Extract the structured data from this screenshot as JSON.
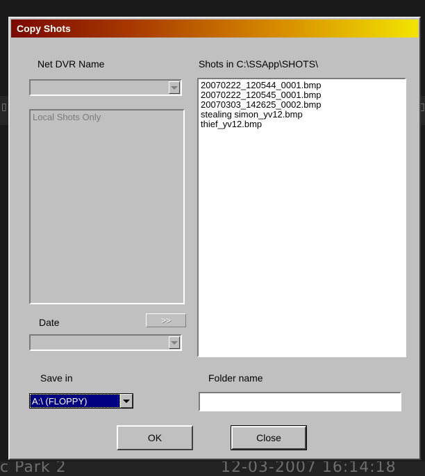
{
  "dialog": {
    "title": "Copy Shots",
    "net_dvr_label": "Net DVR Name",
    "net_dvr_value": "",
    "dvr_list_items": [
      "Local Shots Only"
    ],
    "shots_label": "Shots  in  C:\\SSApp\\SHOTS\\",
    "shots": [
      "20070222_120544_0001.bmp",
      "20070222_120545_0001.bmp",
      "20070303_142625_0002.bmp",
      "stealing simon_yv12.bmp",
      "thief_yv12.bmp"
    ],
    "date_label": "Date",
    "date_button": ">>",
    "date_value": "",
    "save_in_label": "Save in",
    "save_in_value": "A:\\ (FLOPPY)",
    "folder_name_label": "Folder name",
    "folder_name_value": "",
    "ok_label": "OK",
    "close_label": "Close"
  },
  "background": {
    "bottom_left_text": "c Park 2",
    "bottom_right_text": "12-03-2007  16:14:18"
  },
  "colors": {
    "dialog_face": "#c0c0c0",
    "title_gradient_start": "#7a0800",
    "title_gradient_end": "#f2e400",
    "selection": "#000080"
  }
}
